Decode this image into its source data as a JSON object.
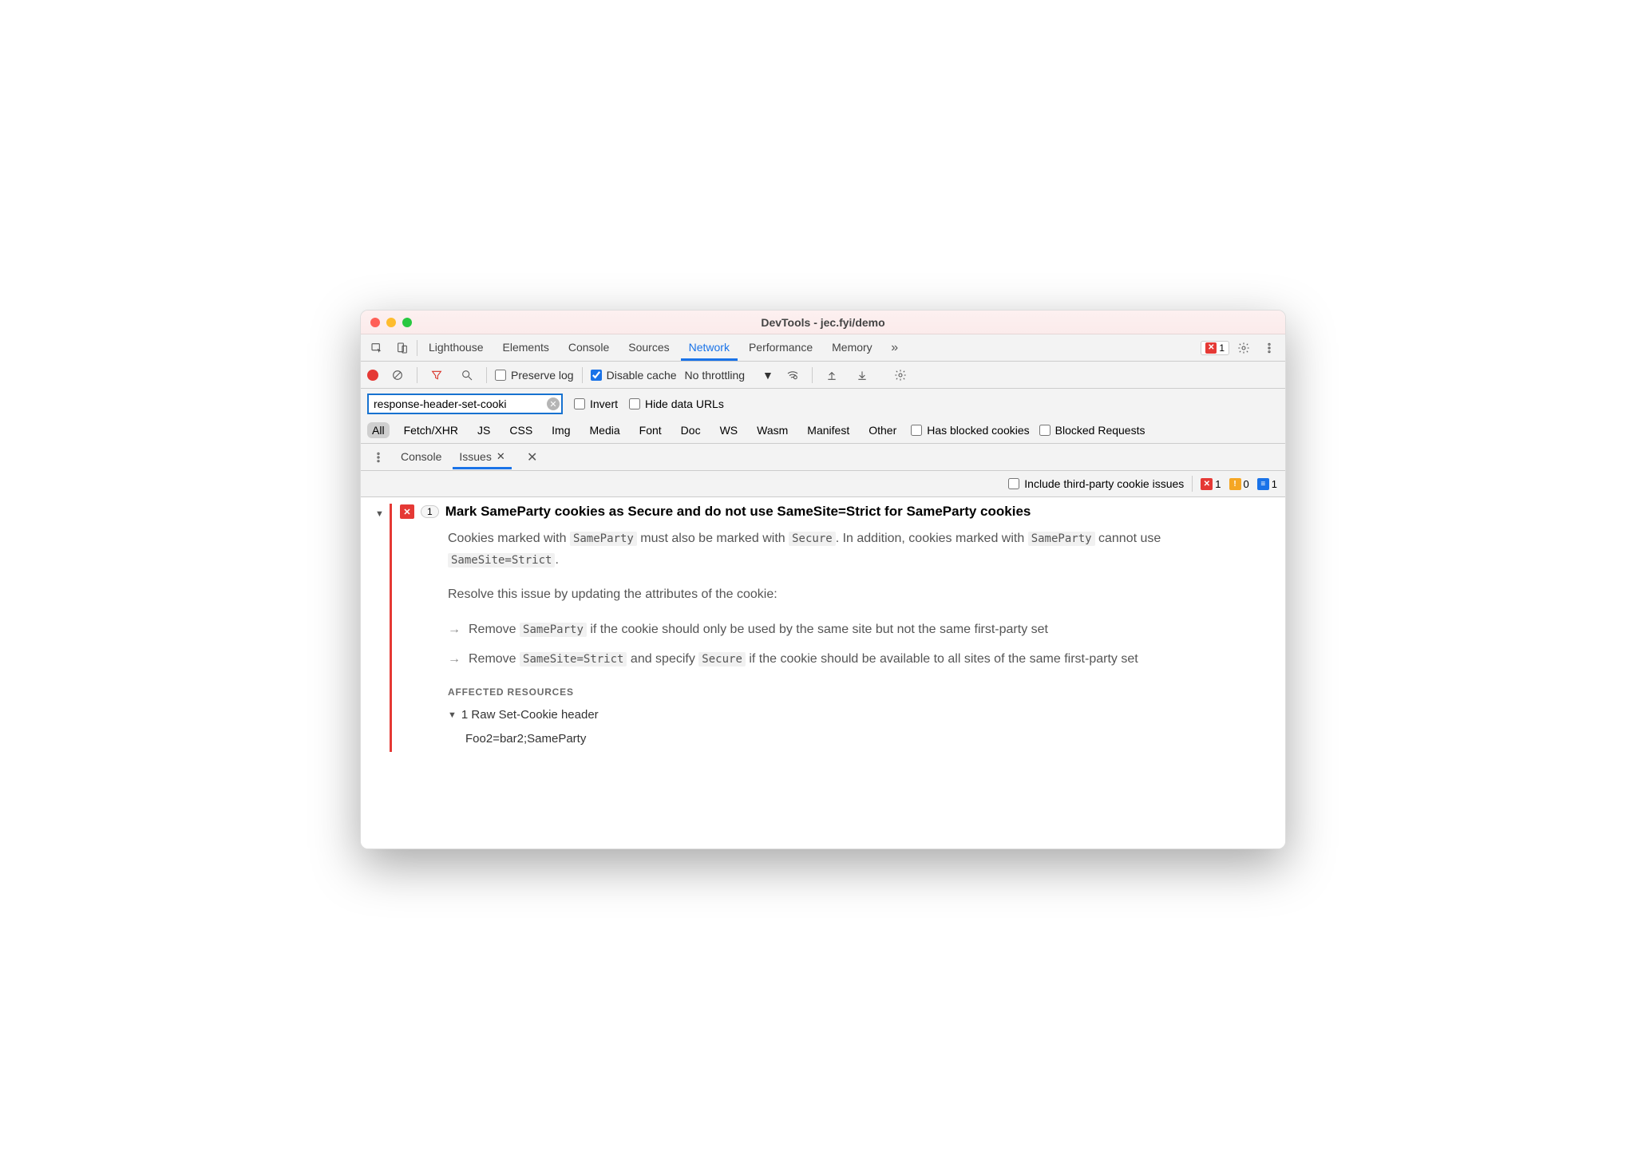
{
  "window": {
    "title": "DevTools - jec.fyi/demo"
  },
  "tabs": {
    "items": [
      "Lighthouse",
      "Elements",
      "Console",
      "Sources",
      "Network",
      "Performance",
      "Memory"
    ],
    "active": "Network",
    "errors": "1"
  },
  "toolbar": {
    "preserve_log": "Preserve log",
    "disable_cache": "Disable cache",
    "throttling": "No throttling"
  },
  "filter": {
    "value": "response-header-set-cooki",
    "invert": "Invert",
    "hide_data_urls": "Hide data URLs"
  },
  "types": [
    "All",
    "Fetch/XHR",
    "JS",
    "CSS",
    "Img",
    "Media",
    "Font",
    "Doc",
    "WS",
    "Wasm",
    "Manifest",
    "Other"
  ],
  "types_active": "All",
  "type_checks": {
    "blocked_cookies": "Has blocked cookies",
    "blocked_requests": "Blocked Requests"
  },
  "drawer": {
    "console": "Console",
    "issues": "Issues"
  },
  "issues_bar": {
    "thirdparty": "Include third-party cookie issues",
    "err": "1",
    "warn": "0",
    "info": "1"
  },
  "issue": {
    "count": "1",
    "title": "Mark SameParty cookies as Secure and do not use SameSite=Strict for SameParty cookies",
    "p1_a": "Cookies marked with ",
    "p1_c1": "SameParty",
    "p1_b": " must also be marked with ",
    "p1_c2": "Secure",
    "p1_c": ". In addition, cookies marked with ",
    "p1_c3": "SameParty",
    "p1_d": " cannot use ",
    "p1_c4": "SameSite=Strict",
    "p1_e": ".",
    "p2": "Resolve this issue by updating the attributes of the cookie:",
    "li1_a": "Remove ",
    "li1_c1": "SameParty",
    "li1_b": " if the cookie should only be used by the same site but not the same first-party set",
    "li2_a": "Remove ",
    "li2_c1": "SameSite=Strict",
    "li2_b": " and specify ",
    "li2_c2": "Secure",
    "li2_c": " if the cookie should be available to all sites of the same first-party set",
    "affected_label": "AFFECTED RESOURCES",
    "resource_head": "1 Raw Set-Cookie header",
    "resource_val": "Foo2=bar2;SameParty"
  }
}
